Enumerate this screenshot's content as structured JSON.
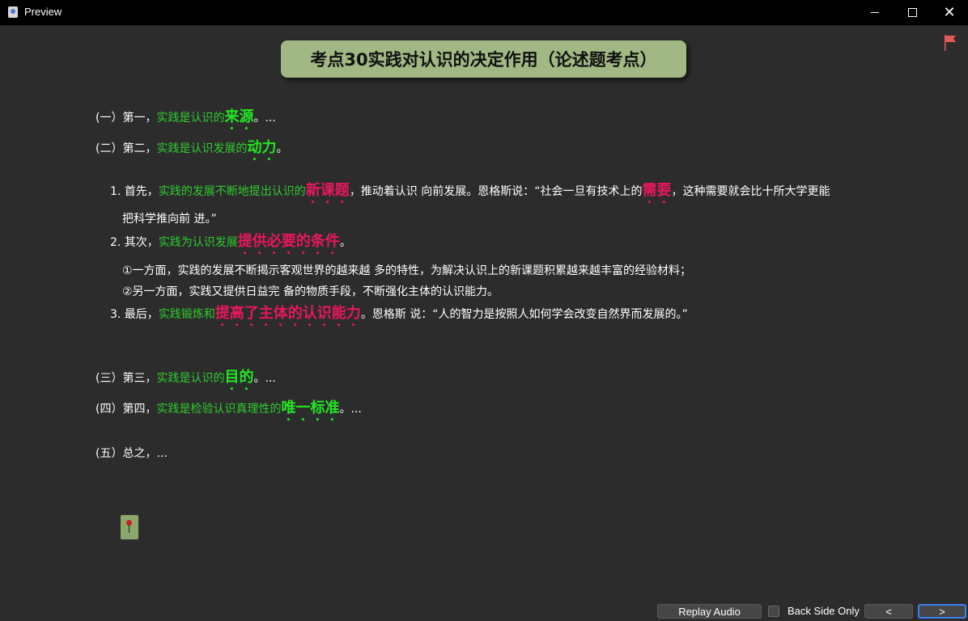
{
  "window": {
    "title": "Preview",
    "icon": "app-icon",
    "controls": [
      "minimize-icon",
      "maximize-icon",
      "close-icon"
    ]
  },
  "card": {
    "title": "考点30实践对认识的决定作用（论述题考点）",
    "flag_icon": "red-flag-icon",
    "colors": {
      "background": "#2c2c2c",
      "title_bg": "#a2b884",
      "green": "#2ecc2e",
      "highlight_green": "#22e622",
      "highlight_red": "#e8175d"
    },
    "lines": {
      "l1": {
        "prefix": "(一）第一，",
        "green": "实践是认识的",
        "key": "来源",
        "suffix": "。..."
      },
      "l2": {
        "prefix": "(二）第二，",
        "green": "实践是认识发展的",
        "key": "动力",
        "suffix": "。"
      },
      "l3": {
        "prefix": "1. 首先，",
        "green": "实践的发展不断地提出认识的",
        "key": "新课题",
        "mid": "，推动着认识 向前发展。恩格斯说：“社会一旦有技术上的",
        "key2": "需要",
        "suffix": "，这种需要就会比十所大学更能"
      },
      "l3b": {
        "text": "把科学推向前 进。”"
      },
      "l4": {
        "prefix": "2. 其次，",
        "green": "实践为认识发展",
        "key": "提供必要的条件",
        "suffix": "。"
      },
      "l5": {
        "text": "①一方面，实践的发展不断揭示客观世界的越来越 多的特性，为解决认识上的新课题积累越来越丰富的经验材料；"
      },
      "l6": {
        "text": "②另一方面，实践又提供日益完 备的物质手段，不断强化主体的认识能力。"
      },
      "l7": {
        "prefix": "3. 最后，",
        "green": "实践锻炼和",
        "key": "提高了主体的认识能力",
        "suffix": "。恩格斯 说：“人的智力是按照人如何学会改变自然界而发展的。”"
      },
      "l8": {
        "prefix": "(三）第三，",
        "green": "实践是认识的",
        "key": "目的",
        "suffix": "。..."
      },
      "l9": {
        "prefix": "(四）第四，",
        "green": "实践是检验认识真理性的",
        "key": "唯一标准",
        "suffix": "。..."
      },
      "l10": {
        "text": "(五）总之，..."
      }
    },
    "pin_icon": "pushpin-icon"
  },
  "bottom": {
    "replay_label": "Replay Audio",
    "back_side_only_label": "Back Side Only",
    "back_side_only_checked": false,
    "prev_label": "<",
    "next_label": ">"
  }
}
